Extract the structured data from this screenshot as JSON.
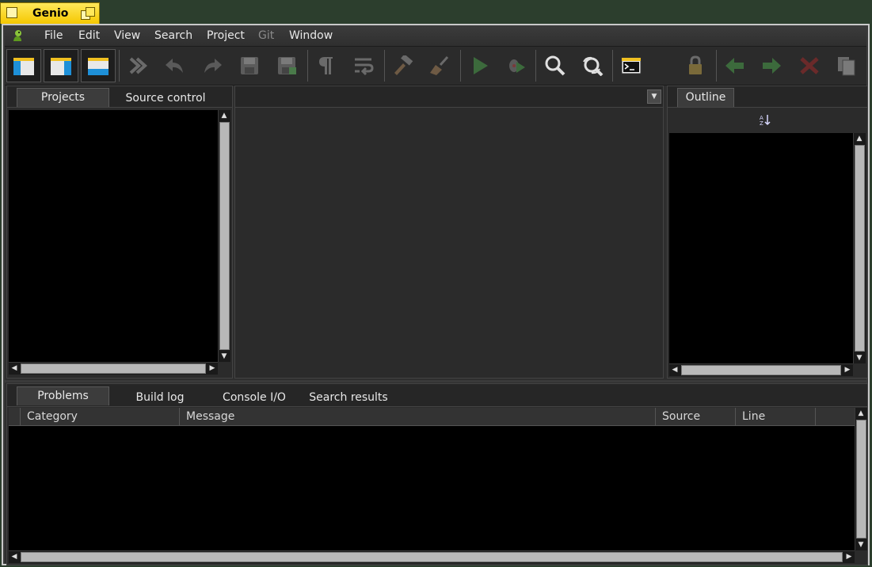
{
  "window": {
    "title": "Genio"
  },
  "menu": {
    "items": [
      {
        "label": "File",
        "enabled": true
      },
      {
        "label": "Edit",
        "enabled": true
      },
      {
        "label": "View",
        "enabled": true
      },
      {
        "label": "Search",
        "enabled": true
      },
      {
        "label": "Project",
        "enabled": true
      },
      {
        "label": "Git",
        "enabled": false
      },
      {
        "label": "Window",
        "enabled": true
      }
    ]
  },
  "toolbar": {
    "buttons": [
      {
        "name": "toggle-projects-panel-icon",
        "state": "pressed"
      },
      {
        "name": "toggle-outline-panel-icon",
        "state": "pressed"
      },
      {
        "name": "toggle-output-panel-icon",
        "state": "pressed"
      },
      {
        "name": "find-in-files-icon",
        "state": "disabled"
      },
      {
        "name": "undo-icon",
        "state": "disabled"
      },
      {
        "name": "redo-icon",
        "state": "disabled"
      },
      {
        "name": "save-icon",
        "state": "disabled"
      },
      {
        "name": "save-all-icon",
        "state": "disabled"
      },
      {
        "name": "show-whitespace-icon",
        "state": "disabled"
      },
      {
        "name": "line-wrap-icon",
        "state": "disabled"
      },
      {
        "name": "build-icon",
        "state": "disabled"
      },
      {
        "name": "clean-icon",
        "state": "disabled"
      },
      {
        "name": "run-icon",
        "state": "disabled"
      },
      {
        "name": "debug-icon",
        "state": "disabled"
      },
      {
        "name": "find-icon",
        "state": "enabled"
      },
      {
        "name": "replace-icon",
        "state": "enabled"
      },
      {
        "name": "terminal-icon",
        "state": "enabled"
      },
      {
        "name": "lock-icon",
        "state": "disabled"
      },
      {
        "name": "back-icon",
        "state": "disabled"
      },
      {
        "name": "forward-icon",
        "state": "disabled"
      },
      {
        "name": "close-file-icon",
        "state": "disabled"
      },
      {
        "name": "file-menu-icon",
        "state": "disabled"
      }
    ]
  },
  "left_panel": {
    "tabs": [
      {
        "label": "Projects",
        "active": true
      },
      {
        "label": "Source control",
        "active": false
      }
    ]
  },
  "outline_panel": {
    "tabs": [
      {
        "label": "Outline",
        "active": true
      }
    ],
    "sort_icon": "sort-az-icon"
  },
  "output_panel": {
    "tabs": [
      {
        "label": "Problems",
        "active": true
      },
      {
        "label": "Build log",
        "active": false
      },
      {
        "label": "Console I/O",
        "active": false
      },
      {
        "label": "Search results",
        "active": false
      }
    ],
    "columns": [
      "Category",
      "Message",
      "Source",
      "Line"
    ]
  },
  "colors": {
    "title_tab": "#f5c800",
    "background": "#2c3e2d",
    "panel": "#2b2b2b"
  }
}
